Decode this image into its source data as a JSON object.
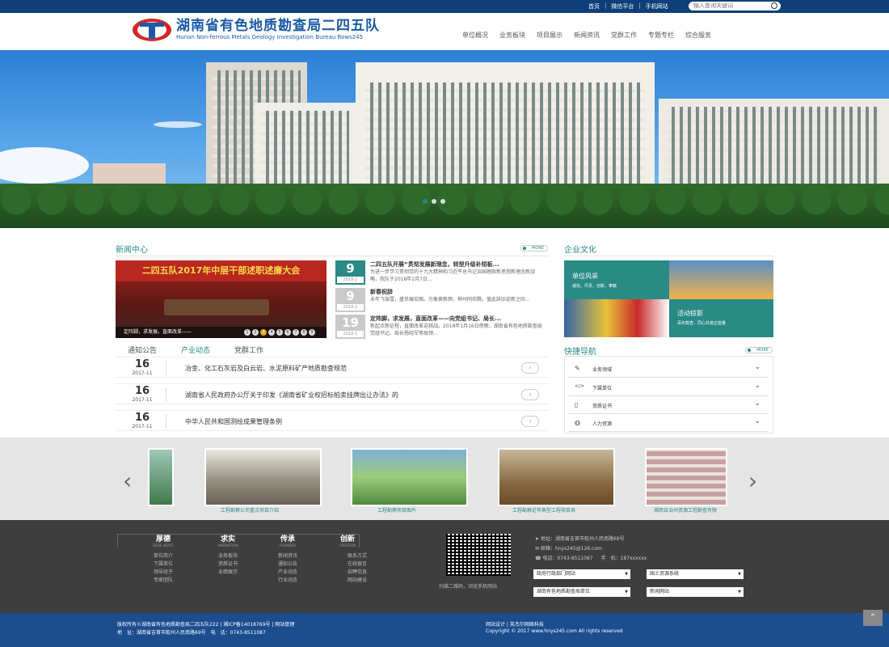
{
  "topbar": {
    "home": "首页",
    "sep1": "|",
    "wechat": "微信平台",
    "sep2": "|",
    "mobile": "手机网站",
    "search_placeholder": "输入查询关键词"
  },
  "header": {
    "title_cn": "湖南省有色地质勘查局二四五队",
    "title_en": "Hunan Non-ferrous Metals Geology Investigation Bureau Rows245"
  },
  "nav": [
    "单位概况",
    "业务板块",
    "项目展示",
    "新闻资讯",
    "党群工作",
    "专题专栏",
    "综合服务"
  ],
  "news": {
    "title": "新闻中心",
    "more": "MORE",
    "image_banner": "二四五队2017年中层干部述职述廉大会",
    "image_caption": "定阵脚，求发展，直面改革——",
    "pager": [
      "1",
      "2",
      "3",
      "4",
      "5",
      "6",
      "7",
      "8",
      "9"
    ],
    "items": [
      {
        "day": "9",
        "month": "2018-2",
        "title": "二四五队开展“贯彻发展新理念，转型升级补短板...",
        "summary": "为进一步学习贯彻党的十九大精神和习近平总书记治国理政新思想新理念新战略，我队于2018年2月7日..."
      },
      {
        "day": "9",
        "month": "2018-2",
        "title": "新春祝辞",
        "summary": "未年飞瑞雪，盛世展宏图。万象换新颜，神州同欢腾。值此辞旧迎新之际..."
      },
      {
        "day": "19",
        "month": "2018-1",
        "title": "定阵脚，求发展，直面改革——向党组书记、局长...",
        "summary": "新起点新征程，直面改革迎挑战。2018年1月16日傍晚，湖南省有色地质勘查局党组书记、局长杨晓军等局领..."
      }
    ]
  },
  "tabs": [
    "通知公告",
    "产业动态",
    "党群工作"
  ],
  "notices": [
    {
      "day": "16",
      "ym": "2017-11",
      "text": "冶金、化工石灰岩及白云岩、水泥原料矿产地质勘查规范"
    },
    {
      "day": "16",
      "ym": "2017-11",
      "text": "湖南省人民政府办公厅关于印发《湖南省矿业权招标拍卖挂牌出让办法》的"
    },
    {
      "day": "16",
      "ym": "2017-11",
      "text": "中华人民共和国测绘成果管理条例"
    }
  ],
  "culture": {
    "title": "企业文化",
    "card1_title": "单位风采",
    "card1_text": "诚信、尽责、创新、奉献",
    "card2_title": "活动掠影",
    "card2_text": "百年勘查，同心共谱正能量"
  },
  "quicknav": {
    "title": "快捷导航",
    "more": "MORE",
    "items": [
      {
        "icon": "wrench-icon",
        "glyph": "✎",
        "label": "业务领域"
      },
      {
        "icon": "code-icon",
        "glyph": "</>",
        "label": "下属单位"
      },
      {
        "icon": "phone-icon",
        "glyph": "▯",
        "label": "资质证书"
      },
      {
        "icon": "globe-icon",
        "glyph": "◍",
        "label": "人力资源"
      }
    ]
  },
  "carousel": {
    "prev": "‹",
    "next": "›",
    "items": [
      {
        "caption": "工程勘察公司重点项目介绍"
      },
      {
        "caption": "工程勘察项目图片"
      },
      {
        "caption": "工程勘察近年典型工程项目表"
      },
      {
        "caption": "湘西自治州资源工程勘查有限"
      }
    ]
  },
  "footer": {
    "cols": [
      {
        "h": "厚德",
        "e": "DEDE HEART",
        "links": [
          "单位简介",
          "下属单位",
          "领导班子",
          "专家团队"
        ]
      },
      {
        "h": "求实",
        "e": "INNOVATION",
        "links": [
          "业务板块",
          "资质证书",
          "业绩展示"
        ]
      },
      {
        "h": "传承",
        "e": "FOUNDED",
        "links": [
          "新闻资讯",
          "通知公告",
          "产业动态",
          "行业动态"
        ]
      },
      {
        "h": "创新",
        "e": "CREATION",
        "links": [
          "联系方式",
          "在线留言",
          "招聘信息",
          "网站建设"
        ]
      }
    ],
    "qr_caption": "扫描二维码，浏览手机网站",
    "address": "地址：湖南省吉首市乾州人民南路69号",
    "email": "邮箱：hnys245@126.com",
    "phone": "电话：0743-8511087",
    "mobile": "手　机：187xxxxxx",
    "selects": [
      "政府行政部门网站",
      "国土资源系统",
      "湖南有色地质勘查局单位",
      "新闻网站"
    ]
  },
  "bottom": {
    "copyright": "版权所有©湖南省有色地质勘查局二四五队222",
    "icp": "湘ICP备14018769号",
    "manage": "网站管理",
    "address": "地　址：湖南省吉首市乾州人民南路69号　电　话：0743-8511087",
    "design": "网站设计",
    "design_by": "英杰尔网络科技",
    "copy_en": "Copyright © 2017 www.hnys245.com All rights reserved"
  },
  "colors": {
    "primary": "#0e3f7a",
    "teal": "#2a8a86",
    "bottom": "#1b4d8f",
    "footer": "#3e3e3e"
  }
}
